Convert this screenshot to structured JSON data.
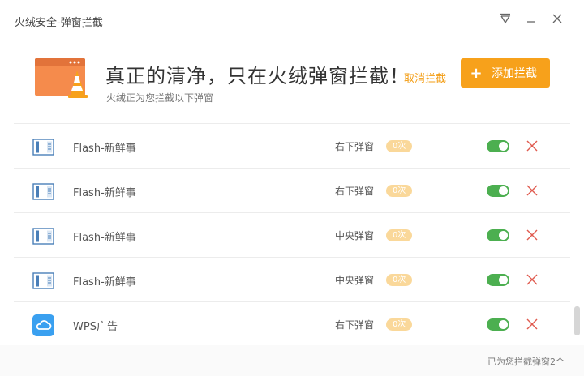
{
  "window": {
    "title": "火绒安全-弹窗拦截"
  },
  "banner": {
    "headline": "真正的清净，只在火绒弹窗拦截！",
    "subline": "火绒正为您拦截以下弹窗",
    "cancel_label": "取消拦截",
    "add_label": "添加拦截"
  },
  "rows": [
    {
      "icon": "window-icon",
      "name": "Flash-新鲜事",
      "position": "右下弹窗",
      "count": "0次",
      "enabled": true
    },
    {
      "icon": "window-icon",
      "name": "Flash-新鲜事",
      "position": "右下弹窗",
      "count": "0次",
      "enabled": true
    },
    {
      "icon": "window-icon",
      "name": "Flash-新鲜事",
      "position": "中央弹窗",
      "count": "0次",
      "enabled": true
    },
    {
      "icon": "window-icon",
      "name": "Flash-新鲜事",
      "position": "中央弹窗",
      "count": "0次",
      "enabled": true
    },
    {
      "icon": "wps-cloud-icon",
      "name": "WPS广告",
      "position": "右下弹窗",
      "count": "0次",
      "enabled": true
    }
  ],
  "footer": {
    "status": "已为您拦截弹窗2个"
  },
  "colors": {
    "accent": "#f7a11b",
    "toggle_on": "#4caf50",
    "delete": "#e05a4f",
    "wps_blue": "#3aa0f0"
  }
}
